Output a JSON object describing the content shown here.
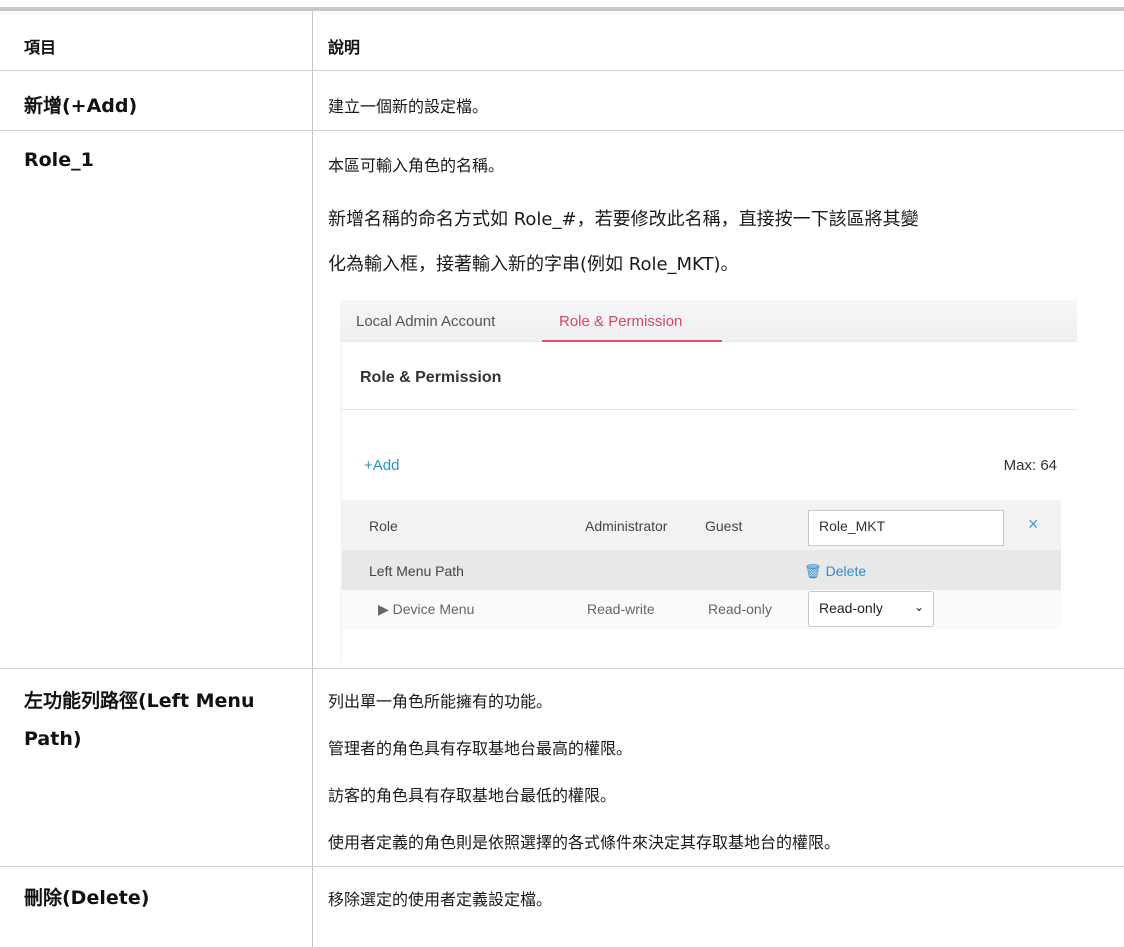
{
  "header": {
    "col1": "項目",
    "col2": "說明"
  },
  "rows": {
    "add": {
      "item": "新增(+Add)",
      "desc": "建立一個新的設定檔。"
    },
    "role": {
      "item": "Role_1",
      "desc1": "本區可輸入角色的名稱。",
      "desc2": "新增名稱的命名方式如 Role_#，若要修改此名稱，直接按一下該區將其變",
      "desc3": "化為輸入框，接著輸入新的字串(例如 Role_MKT)。"
    },
    "left_menu": {
      "item_line1": "左功能列路徑(Left Menu",
      "item_line2": "Path)",
      "desc1": "列出單一角色所能擁有的功能。",
      "desc2": "管理者的角色具有存取基地台最高的權限。",
      "desc3": "訪客的角色具有存取基地台最低的權限。",
      "desc4": "使用者定義的角色則是依照選擇的各式條件來決定其存取基地台的權限。"
    },
    "delete": {
      "item": "刪除(Delete)",
      "desc": "移除選定的使用者定義設定檔。"
    }
  },
  "screenshot": {
    "tabs": [
      "Local Admin Account",
      "Role & Permission"
    ],
    "panel_title": "Role & Permission",
    "add_label": "+Add",
    "max_label": "Max: 64",
    "role_row": {
      "label": "Role",
      "col_admin": "Administrator",
      "col_guest": "Guest",
      "input_value": "Role_MKT",
      "clear_icon": "×"
    },
    "lmp_row": {
      "label": "Left Menu Path",
      "delete_label": "🗑 Delete"
    },
    "device_row": {
      "label": "▶  Device Menu",
      "admin": "Read-write",
      "guest": "Read-only",
      "select_value": "Read-only",
      "chevron": "⌄"
    }
  },
  "colors": {
    "accent_tab": "#d9485f",
    "link": "#2a8fd1",
    "rule": "#c8c8c8"
  }
}
